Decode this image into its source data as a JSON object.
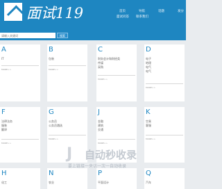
{
  "header": {
    "brand": "面试119",
    "nav": [
      "首页",
      "导航",
      "话题",
      "发分",
      "面试问答",
      "联系我们"
    ]
  },
  "search": {
    "placeholder": "请输入关键词",
    "button_label": "搜索"
  },
  "cards": [
    {
      "letter": "A",
      "items": [
        "IT"
      ],
      "more": "MORE>>"
    },
    {
      "letter": "B",
      "items": [
        "包装"
      ],
      "more": "MORE>>"
    },
    {
      "letter": "C",
      "items": [
        "财务会计和财经类",
        "传媒",
        "采购"
      ],
      "more": "MORE>>"
    },
    {
      "letter": "D",
      "items": [
        "电子",
        "地理",
        "电气",
        "电气"
      ],
      "more": "MORE>>"
    },
    {
      "letter": "F",
      "items": [
        "法律法务",
        "服装",
        "翻译"
      ],
      "more": "MORE>>"
    },
    {
      "letter": "G",
      "items": [
        "公务员",
        "公务员遴选"
      ],
      "more": "MORE>>"
    },
    {
      "letter": "J",
      "items": [
        "金融",
        "建筑",
        "交通"
      ],
      "more": "MORE>>"
    },
    {
      "letter": "K",
      "items": [
        "空乘",
        "客服"
      ],
      "more": "MORE>>"
    },
    {
      "letter": "H",
      "items": [
        "化工"
      ],
      "more": ""
    },
    {
      "letter": "N",
      "items": [
        "农业"
      ],
      "more": ""
    },
    {
      "letter": "P",
      "items": [
        "平面设计"
      ],
      "more": ""
    },
    {
      "letter": "Q",
      "items": [
        "汽车"
      ],
      "more": ""
    }
  ],
  "watermark": {
    "title": "自动秒收录",
    "tagline": "要上链接一来访一次一自动收录"
  },
  "colors": {
    "header_bg": "#1e86c1",
    "letter": "#1e86c1",
    "page_bg": "#e9ecef"
  }
}
